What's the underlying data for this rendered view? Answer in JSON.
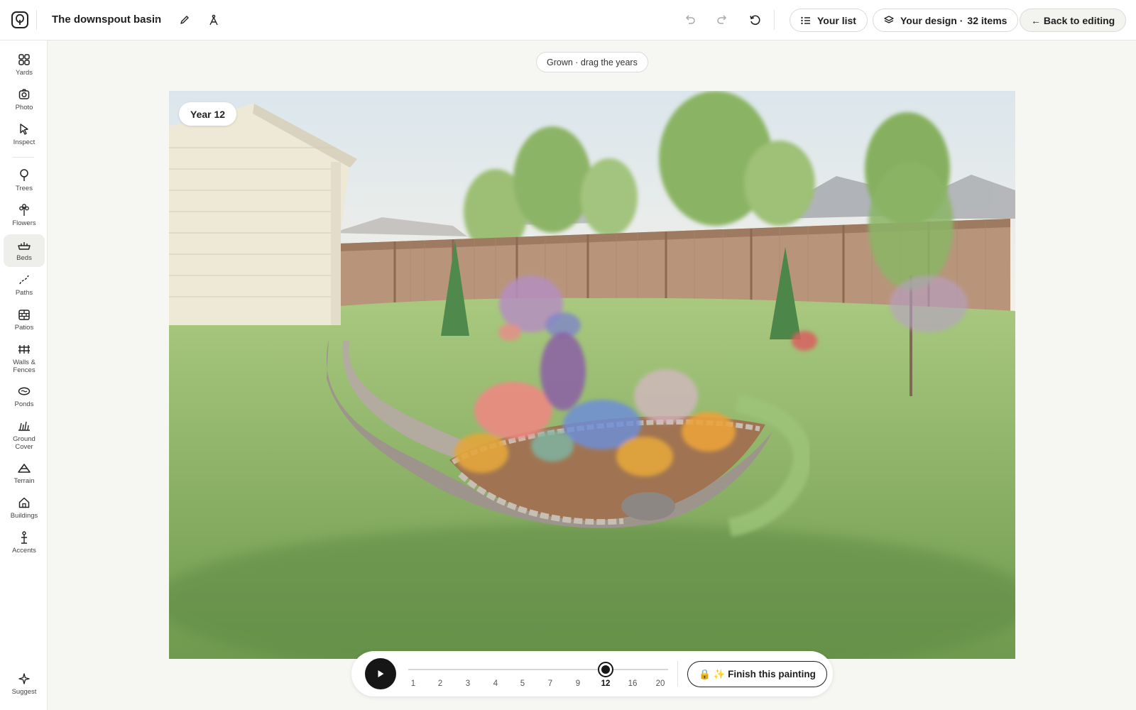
{
  "header": {
    "project_title": "The downspout basin",
    "project_caret": "▾",
    "your_list_label": "Your list",
    "your_design_label": "Your design ·",
    "your_design_count": "32 items",
    "back_label": "← Back to editing",
    "icons": [
      "app-logo",
      "pencil-icon",
      "compass-icon",
      "undo-icon",
      "redo-icon",
      "reset-icon",
      "list-icon",
      "layers-icon"
    ]
  },
  "sidebar": {
    "items": [
      {
        "label": "Yards",
        "icon": "grid-icon"
      },
      {
        "label": "Photo",
        "icon": "camera-icon"
      },
      {
        "label": "Inspect",
        "icon": "pointer-icon"
      },
      {
        "label": "Trees",
        "icon": "tree-icon"
      },
      {
        "label": "Flowers",
        "icon": "flower-icon"
      },
      {
        "label": "Beds",
        "icon": "bed-icon",
        "active": true
      },
      {
        "label": "Paths",
        "icon": "path-icon"
      },
      {
        "label": "Patios",
        "icon": "patio-icon"
      },
      {
        "label": "Walls & Fences",
        "icon": "fence-icon"
      },
      {
        "label": "Ponds",
        "icon": "pond-icon"
      },
      {
        "label": "Ground Cover",
        "icon": "grass-icon"
      },
      {
        "label": "Terrain",
        "icon": "terrain-icon"
      },
      {
        "label": "Buildings",
        "icon": "house-icon"
      },
      {
        "label": "Accents",
        "icon": "accent-icon"
      }
    ],
    "suggest_label": "Suggest"
  },
  "canvas": {
    "hint": "Grown · drag the years",
    "year_label": "Year 12"
  },
  "timeline": {
    "years": [
      "1",
      "2",
      "3",
      "4",
      "5",
      "7",
      "9",
      "12",
      "16",
      "20"
    ],
    "current_year": "12",
    "finish_label": "🔒 ✨ Finish this painting"
  },
  "colors": {
    "accent": "#161616",
    "lawn": "#8fb96a",
    "fence": "#b08c6e",
    "siding": "#eee8d6",
    "mulch": "#a07452"
  }
}
